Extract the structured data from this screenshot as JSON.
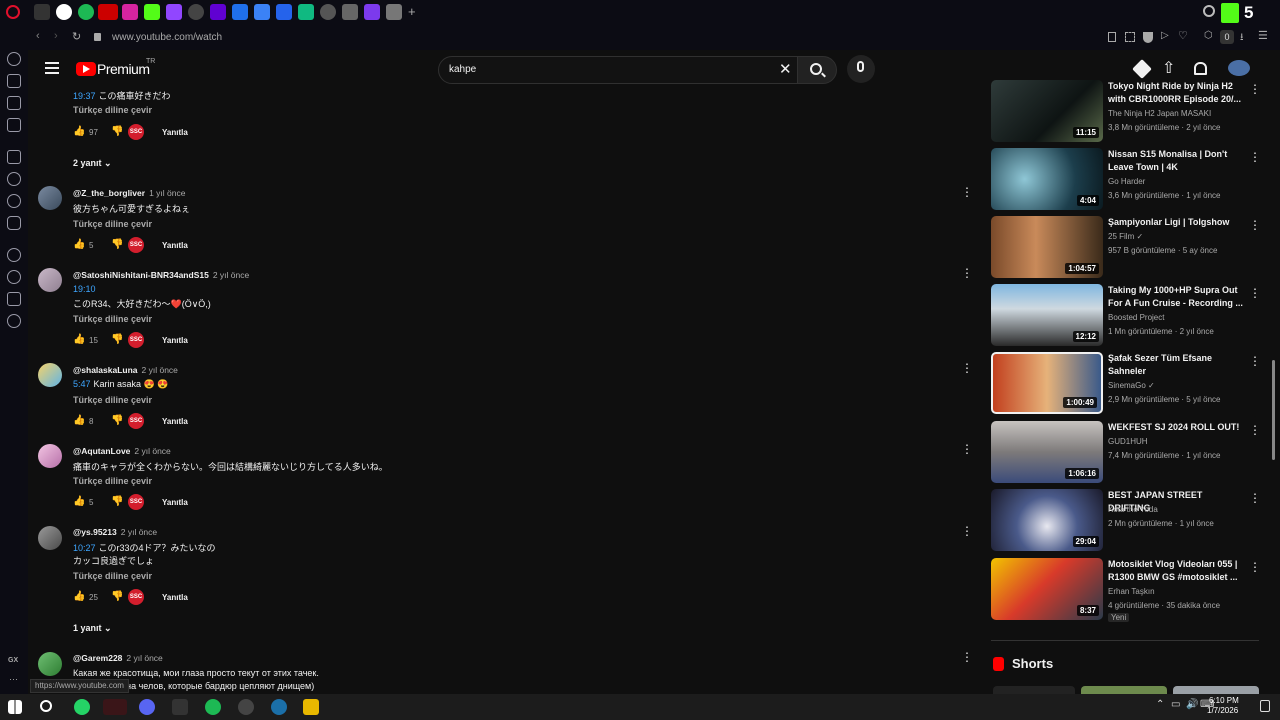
{
  "browser": {
    "url": "www.youtube.com/watch",
    "status_link": "https://www.youtube.com",
    "badge_count": "0",
    "sidebar_label": "GX",
    "tab_badge": "5"
  },
  "header": {
    "brand": "Premium",
    "region": "TR",
    "search_value": "kahpe"
  },
  "comments": [
    {
      "author": "",
      "age": "",
      "timestamp": "19:37",
      "text": "この痛車好きだわ",
      "translate": "Türkçe diline çevir",
      "likes": "97",
      "reply": "Yanıtla",
      "replies": "2 yanıt"
    },
    {
      "author": "@Z_the_borgliver",
      "age": "1 yıl önce",
      "timestamp": "",
      "text": "彼方ちゃん可愛すぎるよねぇ",
      "translate": "Türkçe diline çevir",
      "likes": "5",
      "reply": "Yanıtla",
      "replies": ""
    },
    {
      "author": "@SatoshiNishitani-BNR34andS15",
      "age": "2 yıl önce",
      "timestamp": "19:10",
      "text": "このR34、大好きだわ〜❤️(Ö∨Ö,)",
      "translate": "Türkçe diline çevir",
      "likes": "15",
      "reply": "Yanıtla",
      "replies": ""
    },
    {
      "author": "@shalaskaLuna",
      "age": "2 yıl önce",
      "timestamp": "5:47",
      "text": "Karin asaka 😍 😍",
      "translate": "Türkçe diline çevir",
      "likes": "8",
      "reply": "Yanıtla",
      "replies": ""
    },
    {
      "author": "@AqutanLove",
      "age": "2 yıl önce",
      "timestamp": "",
      "text": "痛車のキャラが全くわからない。今回は結構綺麗ないじり方してる人多いね。",
      "translate": "Türkçe diline çevir",
      "likes": "5",
      "reply": "Yanıtla",
      "replies": ""
    },
    {
      "author": "@ys.95213",
      "age": "2 yıl önce",
      "timestamp": "10:27",
      "text": "このr33の4ドア？みたいなの",
      "text2": "カッコ良過ぎでしょ",
      "translate": "Türkçe diline çevir",
      "likes": "25",
      "reply": "Yanıtla",
      "replies": "1 yanıt"
    },
    {
      "author": "@Garem228",
      "age": "2 yıl önce",
      "timestamp": "",
      "text": "Какая же красотища, мои глаза просто текут от этих тачек.",
      "text2": "но смотреть на челов, которые бардюр цепляют днищем)"
    }
  ],
  "badge_text": "SSC",
  "videos": [
    {
      "title": "Tokyo Night Ride by Ninja H2 with CBR1000RR Episode 20/...",
      "channel": "The Ninja H2 Japan MASAKI",
      "views": "3,8 Mn görüntüleme",
      "age": "2 yıl önce",
      "duration": "11:15"
    },
    {
      "title": "Nissan S15 Monalisa | Don't Leave Town | 4K",
      "channel": "Go Harder",
      "views": "3,6 Mn görüntüleme",
      "age": "1 yıl önce",
      "duration": "4:04"
    },
    {
      "title": "Şampiyonlar Ligi | Tolgshow",
      "channel": "25 Film ✓",
      "views": "957 B görüntüleme",
      "age": "5 ay önce",
      "duration": "1:04:57"
    },
    {
      "title": "Taking My 1000+HP Supra Out For A Fun Cruise - Recording ...",
      "channel": "Boosted Project",
      "views": "1 Mn görüntüleme",
      "age": "2 yıl önce",
      "duration": "12:12"
    },
    {
      "title": "Şafak Sezer Tüm Efsane Sahneler",
      "channel": "SinemaGo ✓",
      "views": "2,9 Mn görüntüleme",
      "age": "5 yıl önce",
      "duration": "1:00:49"
    },
    {
      "title": "WEKFEST SJ 2024 ROLL OUT!",
      "channel": "GUD1HUH",
      "views": "7,4 Mn görüntüleme",
      "age": "1 yıl önce",
      "duration": "1:06:16"
    },
    {
      "title": "BEST JAPAN STREET DRIFTING",
      "channel": "Kota the Yoda",
      "views": "2 Mn görüntüleme",
      "age": "1 yıl önce",
      "duration": "29:04"
    },
    {
      "title": "Motosiklet Vlog Videoları 055 | R1300 BMW GS #motosiklet ...",
      "channel": "Erhan Taşkın",
      "views": "4 görüntüleme",
      "age": "35 dakika önce",
      "duration": "8:37",
      "tag": "Yeni"
    }
  ],
  "shorts_label": "Shorts",
  "taskbar": {
    "time": "6:10 PM",
    "date": "1/7/2026"
  },
  "colors": {
    "brand_red": "#ff0000",
    "link_blue": "#3ea6ff",
    "badge_red": "#d31e2d"
  }
}
